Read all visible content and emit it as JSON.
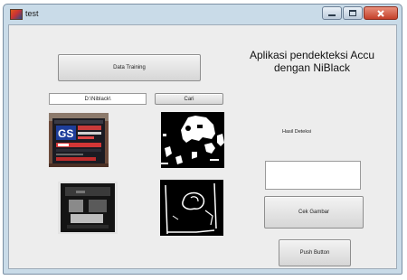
{
  "window": {
    "title": "test",
    "controls": [
      {
        "name": "minimize"
      },
      {
        "name": "maximize"
      },
      {
        "name": "close"
      }
    ]
  },
  "app": {
    "heading_line1": "Aplikasi pendekteksi Accu",
    "heading_line2": "dengan NiBlack",
    "data_training_label": "Data Training",
    "path_value": "D:\\Niblack\\",
    "cari_label": "Cari",
    "hasil_label": "Hasil Deteksi",
    "hasil_value": "",
    "cek_gambar_label": "Cek Gambar",
    "push_button_label": "Push Button"
  },
  "images": {
    "battery_photo_top": {
      "icon": "battery-photo",
      "brand_text": "GS"
    },
    "binary_image_top": {
      "icon": "binary-threshold-image"
    },
    "battery_photo_bottom": {
      "icon": "battery-photo-dark"
    },
    "binary_image_bottom": {
      "icon": "edge-outline-image"
    }
  }
}
